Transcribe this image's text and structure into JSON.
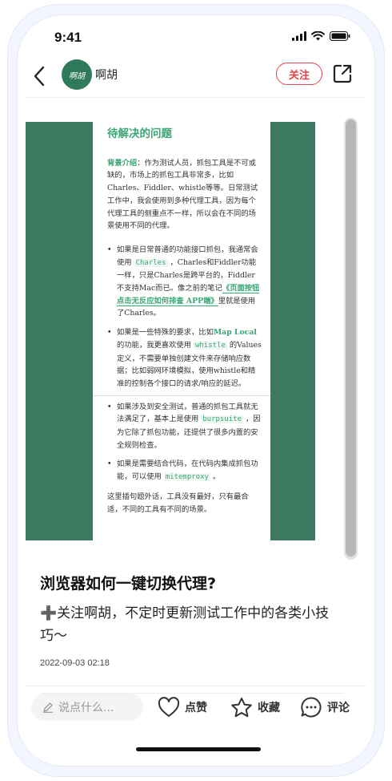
{
  "status_bar": {
    "time": "9:41"
  },
  "header": {
    "author_name": "啊胡",
    "avatar_text": "啊胡",
    "follow_label": "关注"
  },
  "article_image": {
    "heading": "待解决的问题",
    "intro_label": "背景介绍",
    "intro_text": "：作为测试人员，抓包工具是不可或缺的，市场上的抓包工具非常多，比如Charles、Fiddler、whistle等等。日常测试工作中，我会使用到多种代理工具，因为每个代理工具的侧重点不一样，所以会在不同的场景使用不同的代理。",
    "bullet1_a": "如果是日常普通的功能接口抓包，我通常会使用 ",
    "bullet1_code": "Charles",
    "bullet1_b": " ，Charles和Fiddler功能一样，只是Charles是跨平台的，Fiddler不支持Mac而已。像之前的笔记",
    "bullet1_link": "《页面按钮点击无反应如何排查 APP端》",
    "bullet1_c": "里就是使用了Charles。",
    "bullet2_a": "如果是一些特殊的要求，比如",
    "bullet2_hl": "Map Local",
    "bullet2_b": "的功能，我更喜欢使用 ",
    "bullet2_code": "whistle",
    "bullet2_c": " 的Values定义，不需要单独创建文件来存储响应数据；比如弱网环境模拟，使用whistle和精准的控制各个接口的请求/响应的延迟。",
    "bullet3_a": "如果涉及到安全测试，普通的抓包工具就无法满足了，基本上是使用 ",
    "bullet3_code": "burpsuite",
    "bullet3_b": " ，因为它除了抓包功能，还提供了很多内置的安全规则检查。",
    "bullet4_a": "如果是需要结合代码，在代码内集成抓包功能，可以使用 ",
    "bullet4_code": "mitemproxy",
    "bullet4_b": " 。",
    "outro": "这里插句题外话，工具没有最好，只有最合适，不同的工具有不同的场景。"
  },
  "post": {
    "title": "浏览器如何一键切换代理?",
    "description": "➕关注啊胡，不定时更新测试工作中的各类小技巧～",
    "date": "2022-09-03 02:18"
  },
  "toolbar": {
    "comment_placeholder": "说点什么...",
    "like_label": "点赞",
    "collect_label": "收藏",
    "comment_label": "评论"
  },
  "colors": {
    "accent_green": "#3aa776",
    "image_bg": "#3d7861",
    "follow_red": "#e1454c"
  }
}
